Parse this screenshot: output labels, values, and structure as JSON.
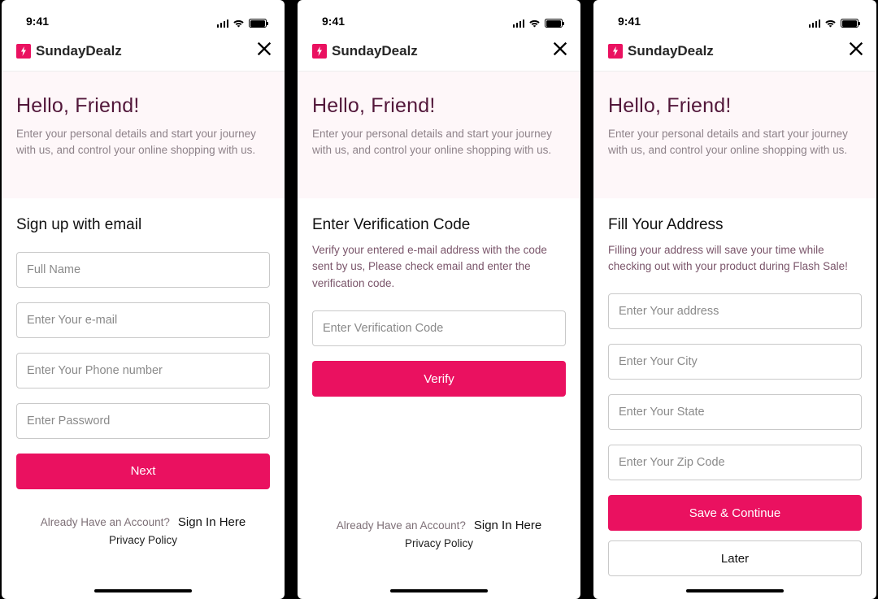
{
  "status": {
    "time": "9:41"
  },
  "brand": {
    "name": "SundayDealz"
  },
  "hero": {
    "greeting": "Hello, Friend!",
    "tagline": "Enter your personal details and start your journey with us, and control your online shopping with us."
  },
  "screens": {
    "signup": {
      "title": "Sign up with email",
      "full_name_ph": "Full Name",
      "email_ph": "Enter Your e-mail",
      "phone_ph": "Enter Your Phone number",
      "password_ph": "Enter Password",
      "next_label": "Next"
    },
    "verify": {
      "title": "Enter Verification Code",
      "subtitle": "Verify your entered e-mail address with the code sent by us, Please check email and enter the verification code.",
      "code_ph": "Enter Verification Code",
      "verify_label": "Verify"
    },
    "address": {
      "title": "Fill Your Address",
      "subtitle": "Filling your address will save your time while checking out with your product during Flash Sale!",
      "address_ph": "Enter Your address",
      "city_ph": "Enter Your City",
      "state_ph": "Enter Your State",
      "zip_ph": "Enter Your Zip Code",
      "save_label": "Save & Continue",
      "later_label": "Later"
    }
  },
  "footer": {
    "prompt": "Already Have an Account?",
    "signin": "Sign In Here",
    "privacy": "Privacy Policy"
  }
}
